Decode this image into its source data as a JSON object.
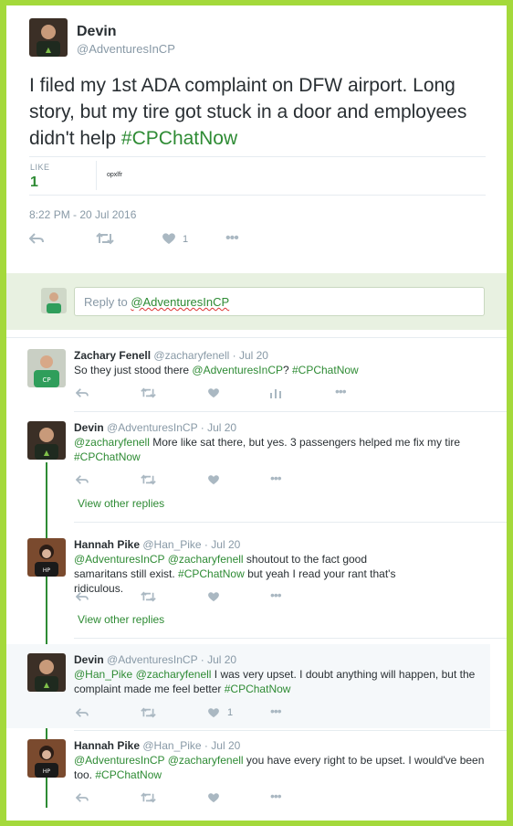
{
  "main_tweet": {
    "author_name": "Devin",
    "author_handle": "@AdventuresInCP",
    "text_before": "I filed my 1st ADA complaint on DFW airport. Long story, but my tire got stuck in a door and employees didn't help ",
    "hashtag": "#CPChatNow",
    "likes_label": "LIKE",
    "likes_count": "1",
    "liker_text": "opxlfr",
    "timestamp": "8:22 PM - 20 Jul 2016",
    "like_action_count": "1"
  },
  "reply_box": {
    "prefix": "Reply to ",
    "mention": "@AdventuresInCP"
  },
  "replies": [
    {
      "name": "Zachary Fenell",
      "handle": "@zacharyfenell",
      "date": "Jul 20",
      "text_prefix": "So they just stood there ",
      "mention1": "@AdventuresInCP",
      "text_mid": "? ",
      "hashtag": "#CPChatNow"
    },
    {
      "name": "Devin",
      "handle": "@AdventuresInCP",
      "date": "Jul 20",
      "mention1": "@zacharyfenell",
      "text_mid": " More like sat there, but yes. 3 passengers helped me fix my tire",
      "hashtag": "#CPChatNow",
      "view_more": "View other replies"
    },
    {
      "name": "Hannah Pike",
      "handle": "@Han_Pike",
      "date": "Jul 20",
      "mention1": "@AdventuresInCP",
      "mention2": "@zacharyfenell",
      "text_mid": " shoutout to the fact good samaritans still exist. ",
      "hashtag": "#CPChatNow",
      "text_end": " but yeah I read your rant that's ridiculous.",
      "view_more": "View other replies"
    },
    {
      "name": "Devin",
      "handle": "@AdventuresInCP",
      "date": "Jul 20",
      "mention1": "@Han_Pike",
      "mention2": "@zacharyfenell",
      "text_mid": " I was very upset. I doubt anything will happen, but the complaint made me feel better ",
      "hashtag": "#CPChatNow",
      "like_count": "1"
    },
    {
      "name": "Hannah Pike",
      "handle": "@Han_Pike",
      "date": "Jul 20",
      "mention1": "@AdventuresInCP",
      "mention2": "@zacharyfenell",
      "text_mid": " you have every right to be upset. I would've been too. ",
      "hashtag": "#CPChatNow"
    }
  ],
  "separator": " · ",
  "colors": {
    "accent": "#2e8b34",
    "frame": "#a4d93b",
    "muted": "#8899a6"
  },
  "icons": [
    "reply-icon",
    "retweet-icon",
    "heart-icon",
    "more-icon",
    "analytics-icon"
  ]
}
